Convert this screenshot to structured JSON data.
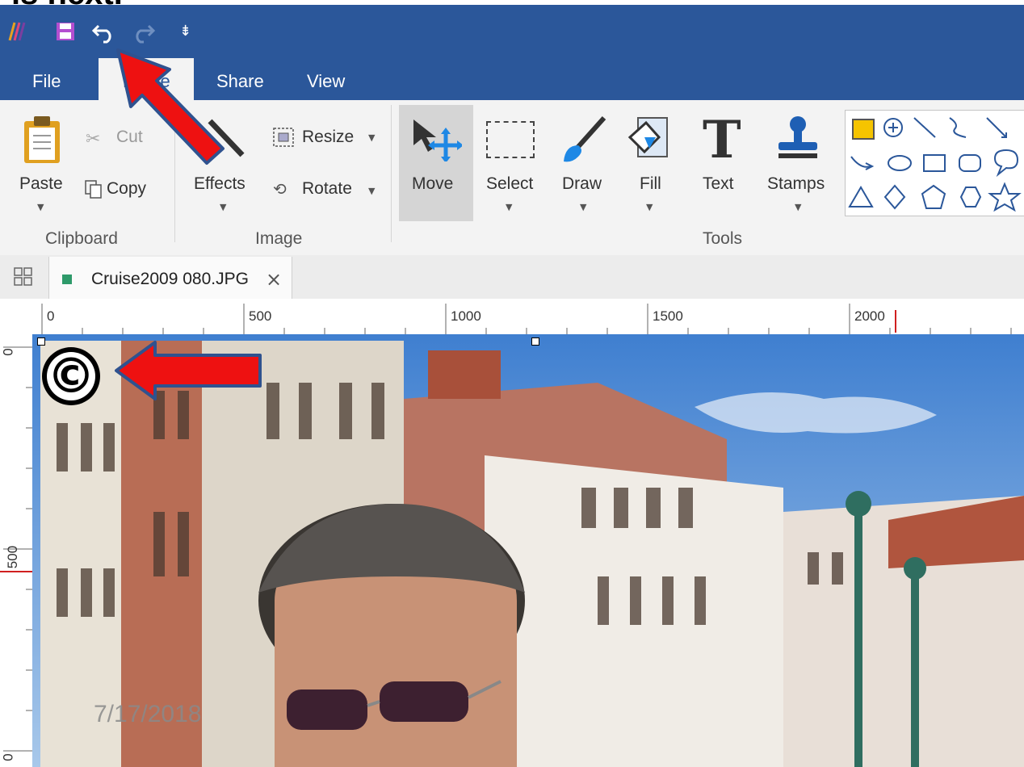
{
  "slide_title_fragment": "is next.",
  "quick_access": {
    "app_icon": "app-logo-icon",
    "save_icon": "save-icon",
    "undo_icon": "undo-icon",
    "redo_icon": "redo-icon",
    "customize_icon": "customize-toolbar-icon"
  },
  "tabs": [
    "File",
    "Home",
    "Share",
    "View"
  ],
  "clipboard": {
    "paste": "Paste",
    "cut": "Cut",
    "copy": "Copy",
    "group": "Clipboard"
  },
  "image": {
    "effects": "Effects",
    "resize": "Resize",
    "rotate": "Rotate",
    "group": "Image"
  },
  "tools": {
    "move": "Move",
    "select": "Select",
    "draw": "Draw",
    "fill": "Fill",
    "text": "Text",
    "stamps": "Stamps",
    "group": "Tools"
  },
  "document": {
    "tab_title": "Cruise2009 080.JPG",
    "close": "×"
  },
  "ruler": {
    "h_marks": [
      "0",
      "500",
      "1000",
      "1500",
      "2000"
    ],
    "v_marks": [
      "0",
      "500",
      "0"
    ]
  },
  "overlay": {
    "date": "7/17/2018",
    "copyright_symbol": "©"
  },
  "colors": {
    "titlebar": "#2b579a",
    "arrow": "#ee1111",
    "arrow_outline": "#2f528f",
    "accent_yellow": "#f5c400"
  }
}
